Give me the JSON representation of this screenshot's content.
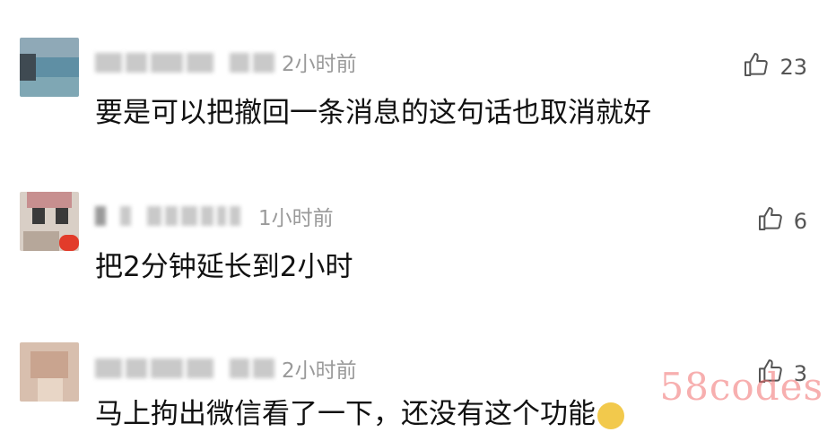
{
  "comments": [
    {
      "time": "2小时前",
      "likes": "23",
      "text": "要是可以把撤回一条消息的这句话也取消就好"
    },
    {
      "time": "1小时前",
      "likes": "6",
      "text": "把2分钟延长到2小时"
    },
    {
      "time": "2小时前",
      "likes": "3",
      "text": "马上拘出微信看了一下，还没有这个功能"
    }
  ],
  "watermark": "58codes",
  "icons": {
    "like": "thumbs-up-icon"
  }
}
